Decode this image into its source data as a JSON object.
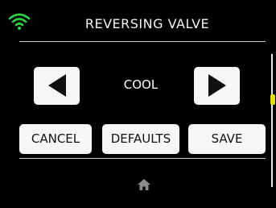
{
  "header": {
    "title": "REVERSING VALVE",
    "wifi_icon": "wifi-icon",
    "wifi_color": "#2fd14a"
  },
  "selector": {
    "prev_icon": "left-arrow-icon",
    "next_icon": "right-arrow-icon",
    "value": "COOL"
  },
  "actions": {
    "cancel_label": "CANCEL",
    "defaults_label": "DEFAULTS",
    "save_label": "SAVE"
  },
  "footer": {
    "home_icon": "home-icon"
  },
  "colors": {
    "background": "#000000",
    "button": "#f6f6f6",
    "scroll_thumb": "#e6dc12"
  }
}
